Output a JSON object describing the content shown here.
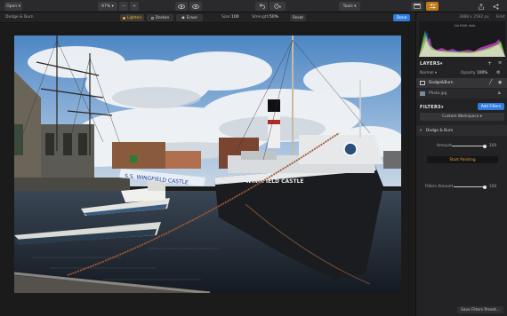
{
  "topbar": {
    "open_label": "Open",
    "zoom": "97%",
    "zoom_minus": "−",
    "zoom_plus": "+",
    "undo_icon": "undo-icon",
    "history_icon": "history-icon",
    "tools_label": "Tools",
    "export_icon": "export-icon"
  },
  "subbar": {
    "tool_name": "Dodge & Burn",
    "modes": [
      {
        "label": "Lighten",
        "active": true
      },
      {
        "label": "Darken",
        "active": false
      },
      {
        "label": "Erase",
        "active": false
      }
    ],
    "size_label": "Size:",
    "size_value": "100",
    "strength_label": "Strength:",
    "strength_value": "50%",
    "reset_label": "Reset",
    "done_label": "Done"
  },
  "image_info": {
    "dimensions": "3888 x 2592 px",
    "bit_depth": "8-bit",
    "histogram_label": "No RAW data"
  },
  "layers": {
    "title": "LAYERS",
    "blend_mode": "Normal",
    "opacity_label": "Opacity",
    "opacity_value": "100%",
    "items": [
      {
        "name": "Dodge&Burn"
      },
      {
        "name": "Photo.jpg"
      }
    ]
  },
  "filters": {
    "title": "FILTERS",
    "add_label": "Add Filters",
    "workspace": "Custom Workspace",
    "filter_name": "Dodge & Burn",
    "amount_label": "Amount",
    "amount_value": "100",
    "start_painting": "Start Painting",
    "filters_amount_label": "Filters Amount",
    "filters_amount_value": "100",
    "save_preset": "Save Filters Preset..."
  },
  "photo": {
    "ship_name_banner": "S.S. WINGFIELD CASTLE",
    "hull_text": "WINGFIELD CASTLE"
  },
  "colors": {
    "accent_blue": "#2f7de1",
    "accent_orange": "#e09a2a"
  }
}
